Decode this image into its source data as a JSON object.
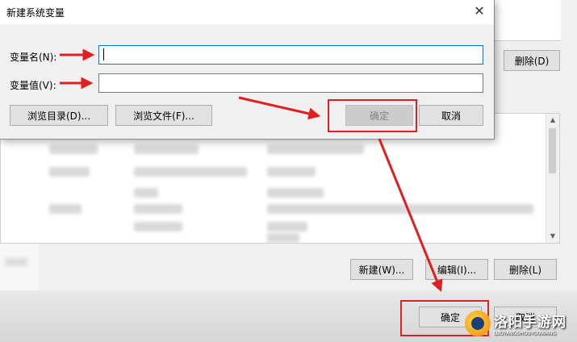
{
  "dialog": {
    "title": "新建系统变量",
    "close_glyph": "✕",
    "name_label": "变量名(N):",
    "name_value": "",
    "value_label": "变量值(V):",
    "value_value": "",
    "browse_dir_label": "浏览目录(D)...",
    "browse_file_label": "浏览文件(F)...",
    "ok_label": "确定",
    "cancel_label": "取消"
  },
  "background": {
    "top_delete_label": "删除(D)",
    "new_label": "新建(W)...",
    "edit_label": "编辑(I)...",
    "delete_label": "删除(L)",
    "ok_label": "确定",
    "cancel_label": "取消"
  },
  "watermark": {
    "cn": "洛阳手游网",
    "en": "LUOYANGSHOUYOUWANG"
  },
  "colors": {
    "annotation_red": "#e02020",
    "focus_blue": "#0078d7"
  }
}
